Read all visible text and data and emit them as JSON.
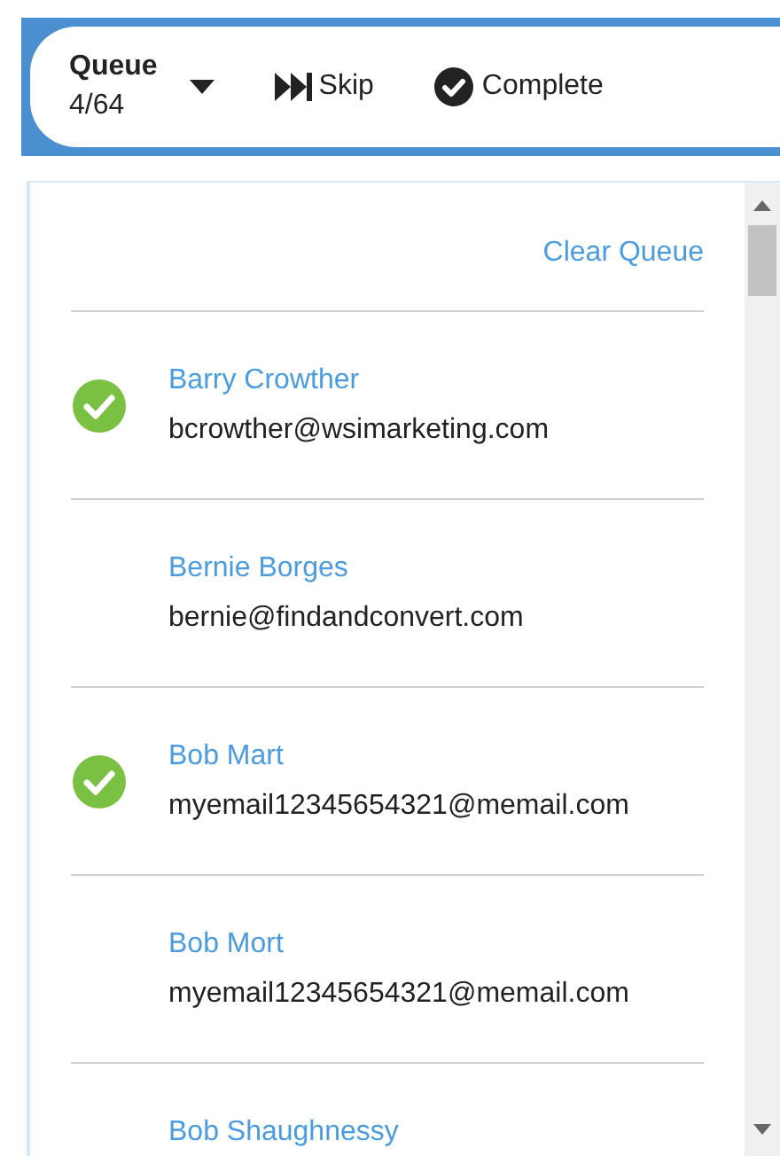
{
  "toolbar": {
    "queue_label": "Queue",
    "queue_count": "4/64",
    "skip_label": "Skip",
    "complete_label": "Complete"
  },
  "queue": {
    "clear_label": "Clear Queue",
    "contacts": [
      {
        "name": "Barry Crowther",
        "email": "bcrowther@wsimarketing.com",
        "completed": true
      },
      {
        "name": "Bernie Borges",
        "email": "bernie@findandconvert.com",
        "completed": false
      },
      {
        "name": "Bob Mart",
        "email": "myemail12345654321@memail.com",
        "completed": true
      },
      {
        "name": "Bob Mort",
        "email": "myemail12345654321@memail.com",
        "completed": false
      },
      {
        "name": "Bob Shaughnessy",
        "completed": false
      }
    ]
  }
}
